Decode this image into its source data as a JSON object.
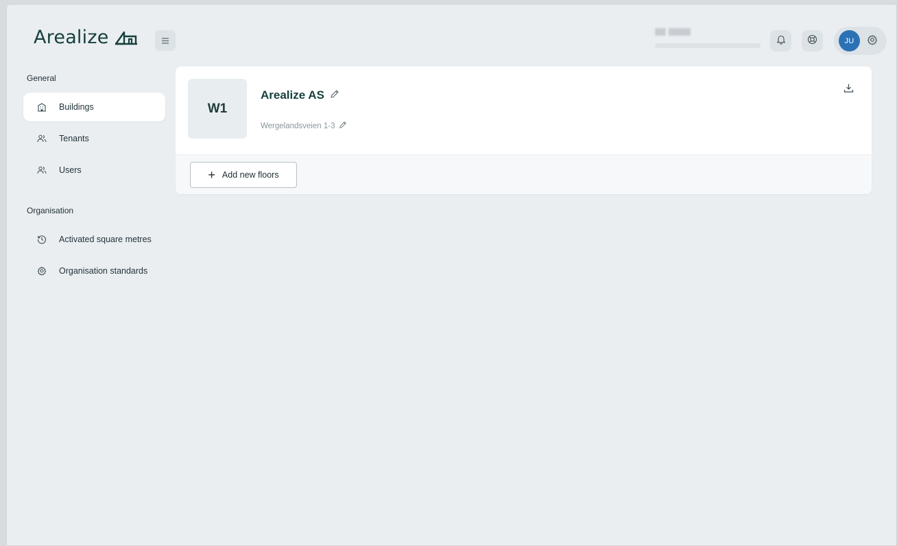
{
  "header": {
    "logo_text": "Arealize",
    "user_initials": "JU"
  },
  "sidebar": {
    "section_general": "General",
    "general_items": [
      {
        "label": "Buildings",
        "icon": "building-icon",
        "active": true
      },
      {
        "label": "Tenants",
        "icon": "users-icon",
        "active": false
      },
      {
        "label": "Users",
        "icon": "users-icon",
        "active": false
      }
    ],
    "section_organisation": "Organisation",
    "organisation_items": [
      {
        "label": "Activated square metres",
        "icon": "history-icon"
      },
      {
        "label": "Organisation standards",
        "icon": "gear-icon"
      }
    ]
  },
  "building": {
    "code": "W1",
    "name": "Arealize AS",
    "address": "Wergelandsveien 1-3"
  },
  "actions": {
    "add_floors_label": "Add new floors"
  },
  "colors": {
    "brand": "#17403d",
    "avatar": "#2a72b5",
    "background": "#eaeef1"
  }
}
